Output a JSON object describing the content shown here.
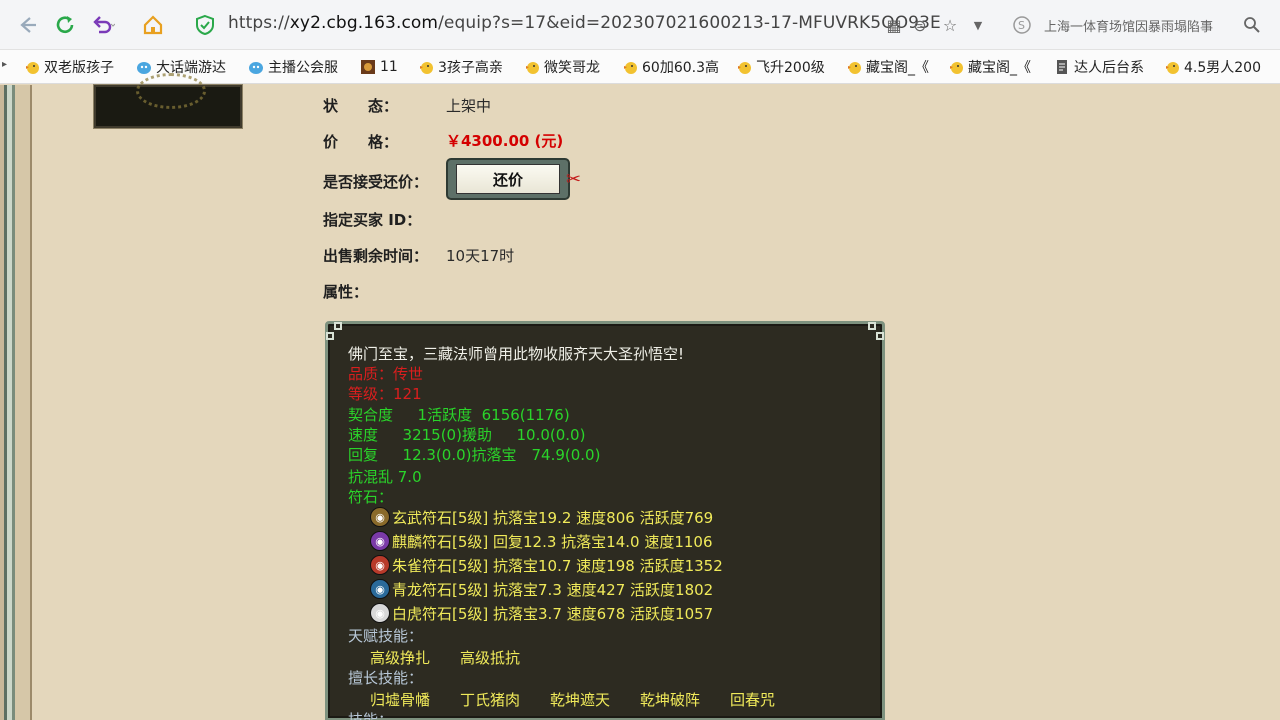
{
  "browser": {
    "url_prefix": "https://",
    "url_host": "xy2.cbg.163.com",
    "url_path": "/equip?s=17&eid=202307021600213-17-MFUVRK5OO93E",
    "search_text": "上海一体育场馆因暴雨塌陷事"
  },
  "bookmarks": [
    {
      "label": "双老版孩子",
      "icon": "chick-icon"
    },
    {
      "label": "大话端游达",
      "icon": "game-icon"
    },
    {
      "label": "主播公会服",
      "icon": "game-icon"
    },
    {
      "label": "11",
      "icon": "image-icon"
    },
    {
      "label": "3孩子高亲",
      "icon": "chick-icon"
    },
    {
      "label": "微笑哥龙",
      "icon": "chick-icon"
    },
    {
      "label": "60加60.3高",
      "icon": "chick-icon"
    },
    {
      "label": "飞升200级",
      "icon": "chick-icon"
    },
    {
      "label": "藏宝阁_《",
      "icon": "chick-icon"
    },
    {
      "label": "藏宝阁_《",
      "icon": "chick-icon"
    },
    {
      "label": "达人后台系",
      "icon": "doc-icon"
    },
    {
      "label": "4.5男人200",
      "icon": "chick-icon"
    }
  ],
  "details": {
    "status_label": "状　　态：",
    "status_value": "上架中",
    "price_label": "价　　格：",
    "price_value": "￥4300.00 (元)",
    "counter_label": "是否接受还价：",
    "counter_button": "还价",
    "buyer_label": "指定买家 ID：",
    "time_label": "出售剩余时间：",
    "time_value": "10天17时",
    "attr_label": "属性："
  },
  "item": {
    "desc": "佛门至宝，三藏法师曾用此物收服齐天大圣孙悟空!",
    "quality": "品质：传世",
    "level": "等级：121",
    "stat1": "契合度　  1活跃度  6156(1176)",
    "stat2": "速度　  3215(0)援助　  10.0(0.0)",
    "stat3": "回复　  12.3(0.0)抗落宝　74.9(0.0)",
    "stat4": "抗混乱 7.0",
    "runes_label": "符石：",
    "runes": [
      {
        "text": "玄武符石[5级] 抗落宝19.2 速度806 活跃度769",
        "color": "#8a6a2a"
      },
      {
        "text": "麒麟符石[5级] 回复12.3 抗落宝14.0 速度1106",
        "color": "#7a3aa8"
      },
      {
        "text": "朱雀符石[5级] 抗落宝10.7 速度198 活跃度1352",
        "color": "#b83a2a"
      },
      {
        "text": "青龙符石[5级] 抗落宝7.3 速度427 活跃度1802",
        "color": "#2a6a9a"
      },
      {
        "text": "白虎符石[5级] 抗落宝3.7 速度678 活跃度1057",
        "color": "#d8d8d8"
      }
    ],
    "talent_label": "天赋技能：",
    "talent_skills": "高级挣扎　　高级抵抗",
    "specialty_label": "擅长技能：",
    "specialty_skills": "归墟骨幡　　丁氏猪肉　　乾坤遮天　　乾坤破阵　　回春咒",
    "skills_label": "技能："
  }
}
